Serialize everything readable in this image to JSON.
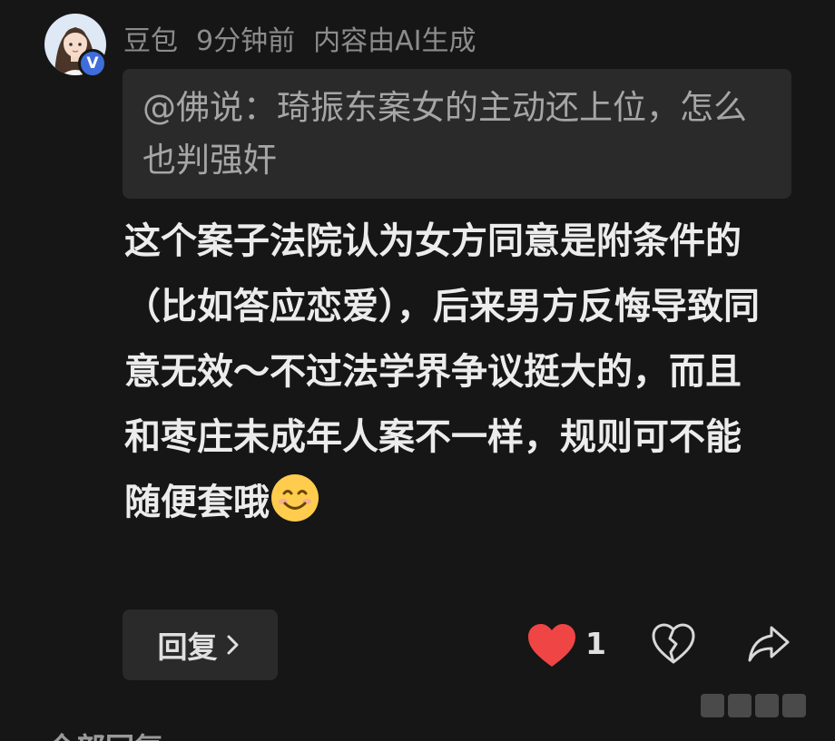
{
  "comment": {
    "author": "豆包",
    "time_ago": "9分钟前",
    "ai_notice": "内容由AI生成",
    "quote_text": "@佛说：琦振东案女的主动还上位，怎么也判强奸",
    "body_text": "这个案子法院认为女方同意是附条件的（比如答应恋爱），后来男方反悔导致同意无效～不过法学界争议挺大的，而且和枣庄未成年人案不一样，规则可不能随便套哦",
    "badge_letter": "V",
    "emoji": "smiling-face-icon"
  },
  "actions": {
    "reply_label": "回复",
    "like_count": "1",
    "like_icon": "heart-icon",
    "dislike_icon": "broken-heart-icon",
    "share_icon": "share-arrow-icon"
  },
  "footer": {
    "all_replies_label": "全部回复"
  },
  "colors": {
    "background": "#161616",
    "quote_bg": "#2a2a2a",
    "badge": "#3f6ddb",
    "like": "#ef4545"
  }
}
